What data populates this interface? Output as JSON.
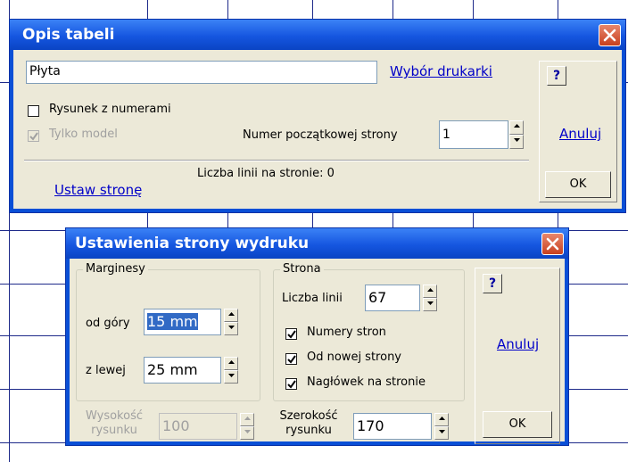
{
  "opis": {
    "title": "Opis tabeli",
    "name_value": "Płyta",
    "printer_link": "Wybór drukarki",
    "chk_numbers_label": "Rysunek z numerami",
    "chk_numbers_checked": false,
    "chk_model_label": "Tylko model",
    "chk_model_checked": true,
    "start_page_label": "Numer początkowej strony",
    "start_page_value": "1",
    "lines_info": "Liczba linii na stronie: 0",
    "page_setup_link": "Ustaw stronę",
    "help_label": "?",
    "cancel_label": "Anuluj",
    "ok_label": "OK"
  },
  "setup": {
    "title": "Ustawienia strony wydruku",
    "margins_group": "Marginesy",
    "top_label": "od góry",
    "top_value": "15 mm",
    "left_label": "z lewej",
    "left_value": "25 mm",
    "page_group": "Strona",
    "lines_label": "Liczba linii",
    "lines_value": "67",
    "chk_page_numbers": "Numery stron",
    "chk_new_page": "Od nowej strony",
    "chk_header": "Nagłówek na stronie",
    "height_label_1": "Wysokość",
    "height_label_2": "rysunku",
    "height_value": "100",
    "width_label_1": "Szerokość",
    "width_label_2": "rysunku",
    "width_value": "170",
    "help_label": "?",
    "cancel_label": "Anuluj",
    "ok_label": "OK"
  }
}
